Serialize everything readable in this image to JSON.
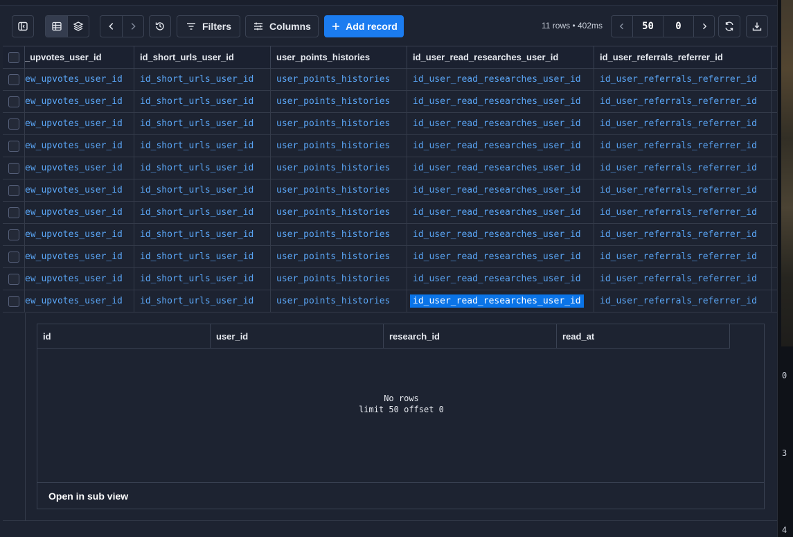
{
  "toolbar": {
    "filters_label": "Filters",
    "columns_label": "Columns",
    "add_record_label": "Add record",
    "rows_info": "11 rows • 402ms",
    "limit_value": "50",
    "offset_value": "0"
  },
  "table": {
    "columns": [
      "_upvotes_user_id",
      "id_short_urls_user_id",
      "user_points_histories",
      "id_user_read_researches_user_id",
      "id_user_referrals_referrer_id"
    ],
    "rows": [
      [
        "ew_upvotes_user_id",
        "id_short_urls_user_id",
        "user_points_histories",
        "id_user_read_researches_user_id",
        "id_user_referrals_referrer_id"
      ],
      [
        "ew_upvotes_user_id",
        "id_short_urls_user_id",
        "user_points_histories",
        "id_user_read_researches_user_id",
        "id_user_referrals_referrer_id"
      ],
      [
        "ew_upvotes_user_id",
        "id_short_urls_user_id",
        "user_points_histories",
        "id_user_read_researches_user_id",
        "id_user_referrals_referrer_id"
      ],
      [
        "ew_upvotes_user_id",
        "id_short_urls_user_id",
        "user_points_histories",
        "id_user_read_researches_user_id",
        "id_user_referrals_referrer_id"
      ],
      [
        "ew_upvotes_user_id",
        "id_short_urls_user_id",
        "user_points_histories",
        "id_user_read_researches_user_id",
        "id_user_referrals_referrer_id"
      ],
      [
        "ew_upvotes_user_id",
        "id_short_urls_user_id",
        "user_points_histories",
        "id_user_read_researches_user_id",
        "id_user_referrals_referrer_id"
      ],
      [
        "ew_upvotes_user_id",
        "id_short_urls_user_id",
        "user_points_histories",
        "id_user_read_researches_user_id",
        "id_user_referrals_referrer_id"
      ],
      [
        "ew_upvotes_user_id",
        "id_short_urls_user_id",
        "user_points_histories",
        "id_user_read_researches_user_id",
        "id_user_referrals_referrer_id"
      ],
      [
        "ew_upvotes_user_id",
        "id_short_urls_user_id",
        "user_points_histories",
        "id_user_read_researches_user_id",
        "id_user_referrals_referrer_id"
      ],
      [
        "ew_upvotes_user_id",
        "id_short_urls_user_id",
        "user_points_histories",
        "id_user_read_researches_user_id",
        "id_user_referrals_referrer_id"
      ],
      [
        "ew_upvotes_user_id",
        "id_short_urls_user_id",
        "user_points_histories",
        "id_user_read_researches_user_id",
        "id_user_referrals_referrer_id"
      ]
    ],
    "selected_row": 10,
    "selected_col": 3
  },
  "subtable": {
    "columns": [
      "id",
      "user_id",
      "research_id",
      "read_at"
    ],
    "empty_line1": "No rows",
    "empty_line2": "limit 50 offset 0",
    "open_label": "Open in sub view"
  },
  "edge_numbers": [
    "0",
    "3",
    "4"
  ],
  "icons": {
    "sidebar_toggle": "sidebar-toggle-icon",
    "grid_view": "grid-view-icon",
    "layers": "layers-icon",
    "back": "chevron-left-icon",
    "forward": "chevron-right-icon",
    "history": "history-icon",
    "filter": "filter-icon",
    "columns": "sliders-icon",
    "add": "plus-icon",
    "refresh": "refresh-icon",
    "download": "download-icon"
  },
  "colors": {
    "accent": "#1b7cf0",
    "link": "#5aa5f5",
    "background": "#1d2331"
  }
}
